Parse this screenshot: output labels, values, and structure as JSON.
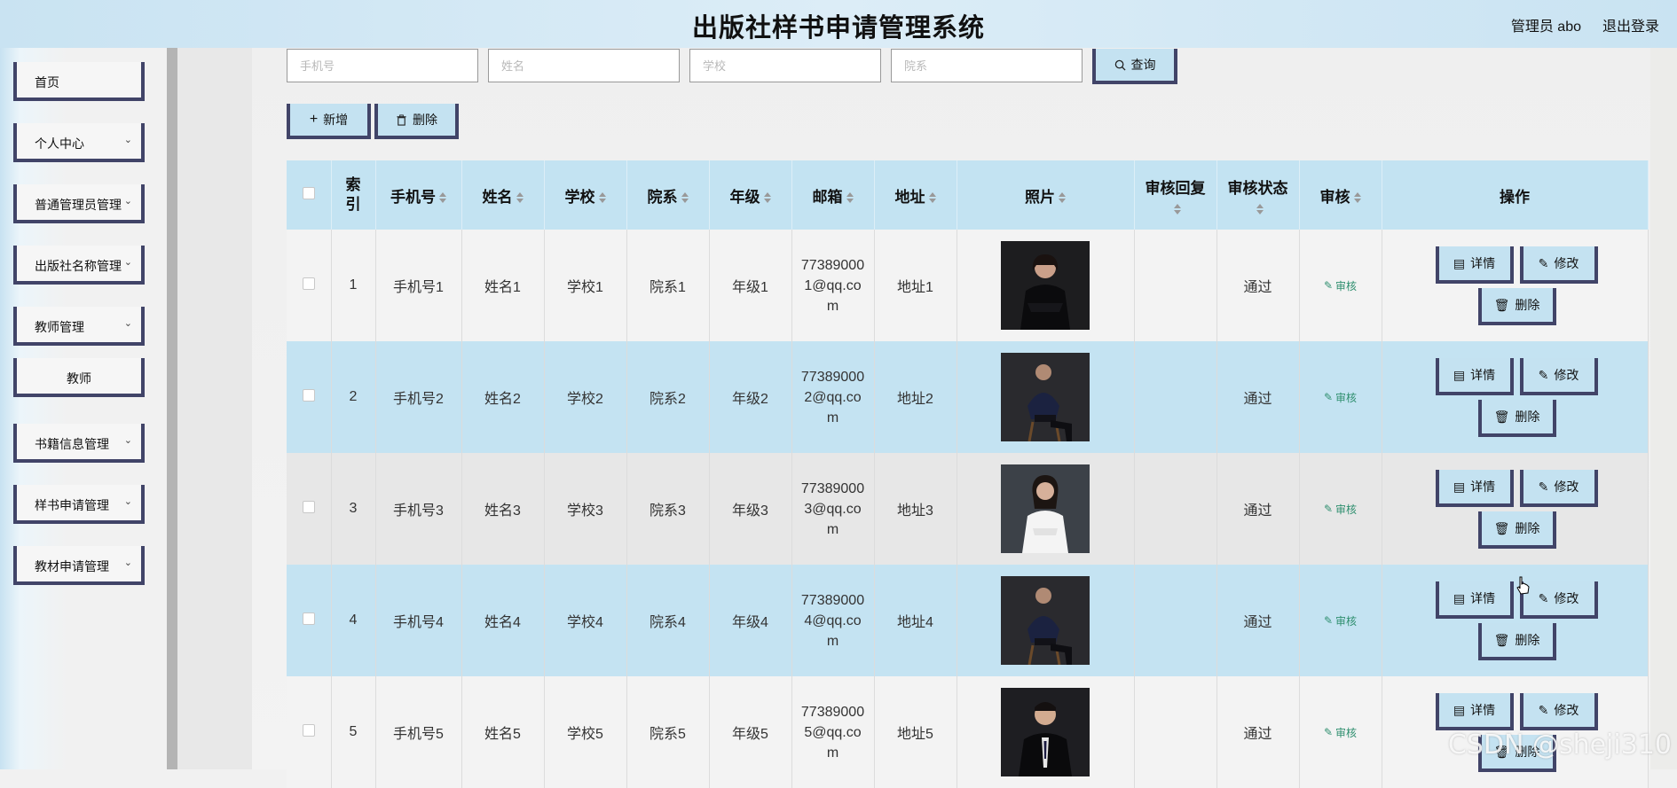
{
  "header": {
    "title": "出版社样书申请管理系统",
    "user_label": "管理员 abo",
    "logout_label": "退出登录"
  },
  "sidebar": {
    "items": [
      {
        "label": "首页"
      },
      {
        "label": "个人中心"
      },
      {
        "label": "普通管理员管理"
      },
      {
        "label": "出版社名称管理"
      },
      {
        "label": "教师管理"
      },
      {
        "label": "教师"
      },
      {
        "label": "书籍信息管理"
      },
      {
        "label": "样书申请管理"
      },
      {
        "label": "教材申请管理"
      }
    ]
  },
  "search": {
    "phone_placeholder": "手机号",
    "name_placeholder": "姓名",
    "school_placeholder": "学校",
    "dept_placeholder": "院系",
    "query_label": "查询"
  },
  "toolbar": {
    "add_label": "新增",
    "delete_label": "删除"
  },
  "table": {
    "columns": {
      "index": "索引",
      "phone": "手机号",
      "name": "姓名",
      "school": "学校",
      "dept": "院系",
      "grade": "年级",
      "email": "邮箱",
      "address": "地址",
      "photo": "照片",
      "reply": "审核回复",
      "status": "审核状态",
      "audit": "审核",
      "ops": "操作"
    },
    "rows": [
      {
        "index": "1",
        "phone": "手机号1",
        "name": "姓名1",
        "school": "学校1",
        "dept": "院系1",
        "grade": "年级1",
        "email": "773890001@qq.com",
        "address": "地址1",
        "reply": "",
        "status": "通过",
        "audit": "审核"
      },
      {
        "index": "2",
        "phone": "手机号2",
        "name": "姓名2",
        "school": "学校2",
        "dept": "院系2",
        "grade": "年级2",
        "email": "773890002@qq.com",
        "address": "地址2",
        "reply": "",
        "status": "通过",
        "audit": "审核"
      },
      {
        "index": "3",
        "phone": "手机号3",
        "name": "姓名3",
        "school": "学校3",
        "dept": "院系3",
        "grade": "年级3",
        "email": "773890003@qq.com",
        "address": "地址3",
        "reply": "",
        "status": "通过",
        "audit": "审核"
      },
      {
        "index": "4",
        "phone": "手机号4",
        "name": "姓名4",
        "school": "学校4",
        "dept": "院系4",
        "grade": "年级4",
        "email": "773890004@qq.com",
        "address": "地址4",
        "reply": "",
        "status": "通过",
        "audit": "审核"
      },
      {
        "index": "5",
        "phone": "手机号5",
        "name": "姓名5",
        "school": "学校5",
        "dept": "院系5",
        "grade": "年级5",
        "email": "773890005@qq.com",
        "address": "地址5",
        "reply": "",
        "status": "通过",
        "audit": "审核"
      }
    ],
    "row_actions": {
      "detail_label": "详情",
      "edit_label": "修改",
      "delete_label": "删除"
    }
  },
  "watermark": "CSDN @sheji310",
  "colors": {
    "accent_border": "#414468",
    "header_bg": "#c3e3f2",
    "audit_link": "#2f8f6f"
  }
}
